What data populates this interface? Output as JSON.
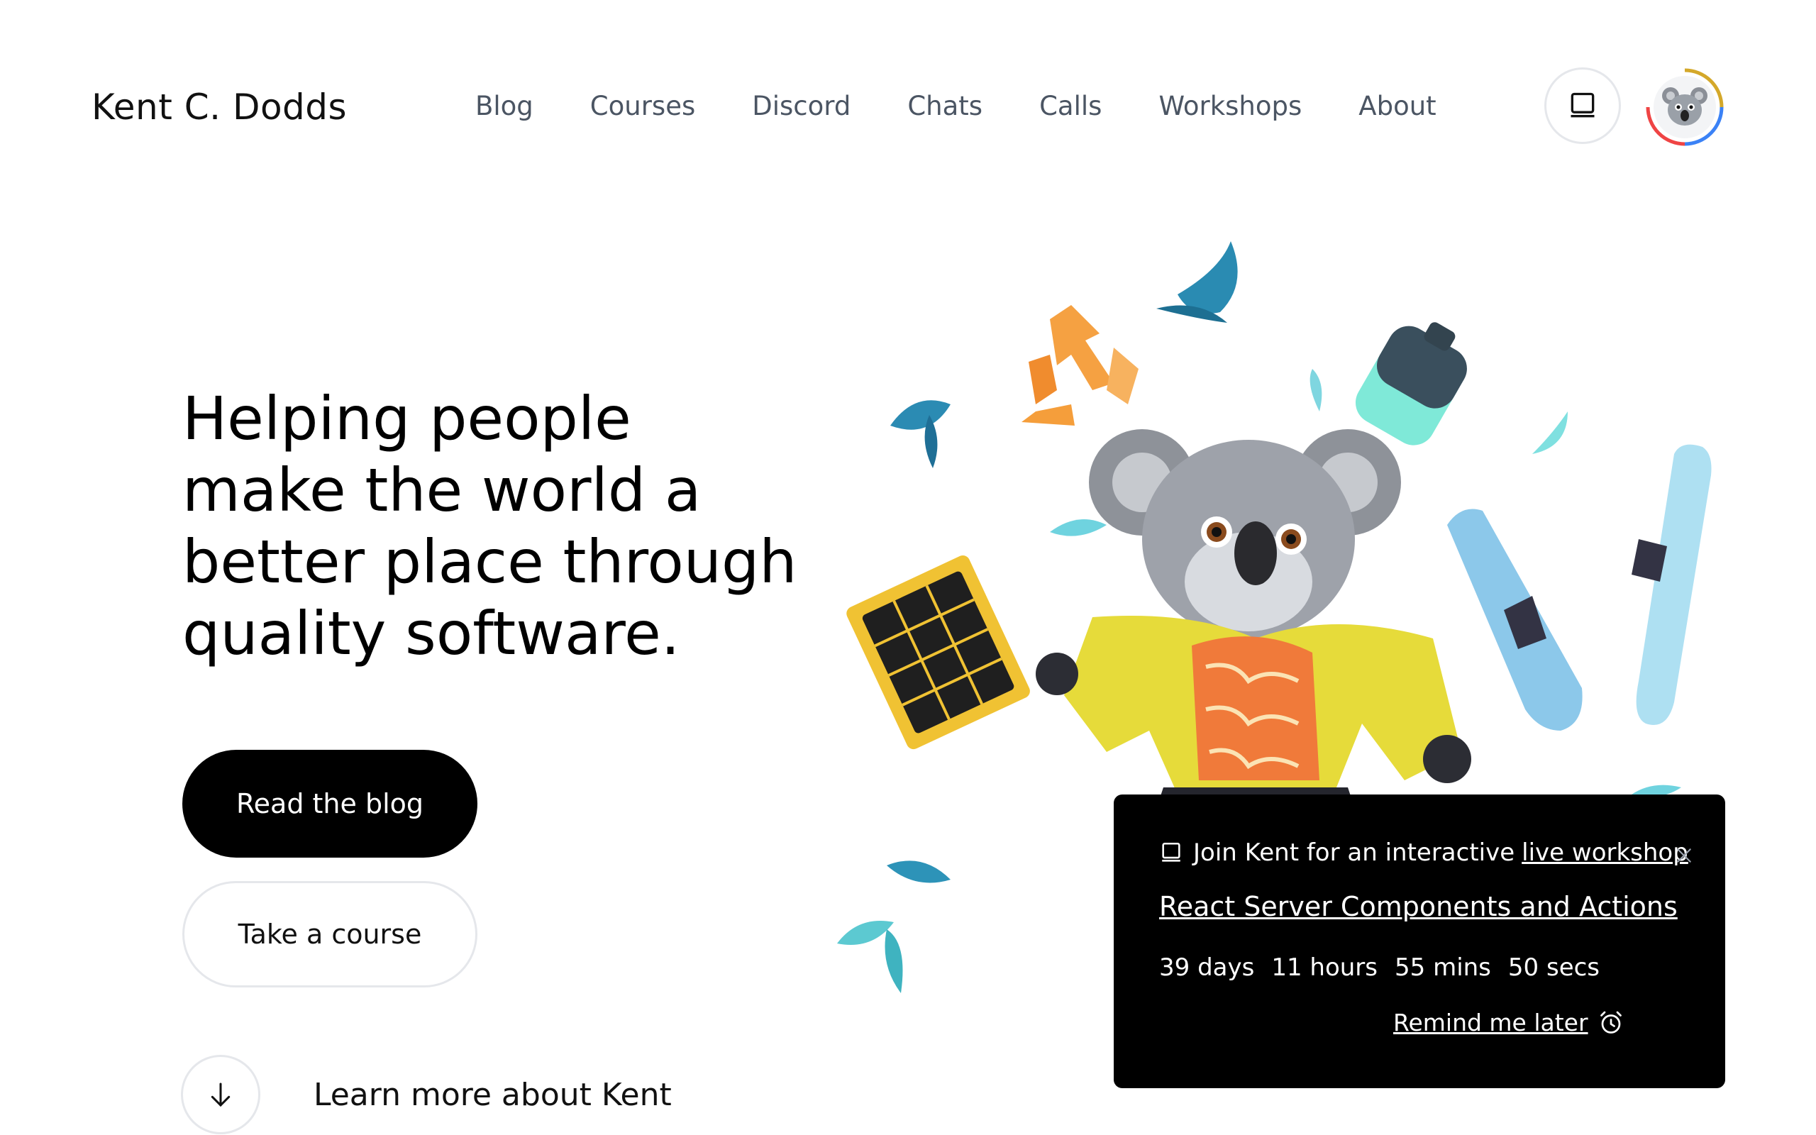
{
  "header": {
    "logo": "Kent C. Dodds",
    "nav": [
      "Blog",
      "Courses",
      "Discord",
      "Chats",
      "Calls",
      "Workshops",
      "About"
    ],
    "mode_toggle_icon": "laptop-icon",
    "avatar_icon": "koala-avatar"
  },
  "hero": {
    "title": "Helping people make the world a better place through quality software.",
    "primary_button": "Read the blog",
    "secondary_button": "Take a course",
    "learn_more": "Learn more about Kent"
  },
  "popup": {
    "intro": "Join Kent for an interactive",
    "intro_link": "live workshop",
    "workshop_title": "React Server Components and Actions",
    "countdown": [
      "39 days",
      "11 hours",
      "55 mins",
      "50 secs"
    ],
    "remind": "Remind me later"
  },
  "colors": {
    "nav_text": "#4b5563",
    "border": "#e5e7eb",
    "primary_bg": "#000000"
  }
}
